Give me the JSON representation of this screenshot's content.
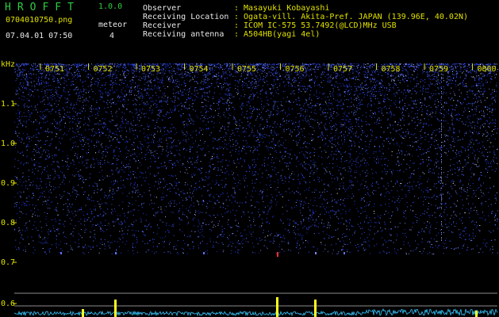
{
  "header": {
    "logo_text": "HROFFT",
    "version": "1.0.0",
    "filename": "0704010750.png",
    "meteor_label": "meteor",
    "date_time": "07.04.01 07:50",
    "meteor_count": "4"
  },
  "info": {
    "rows": [
      {
        "key": "Observer",
        "value": ": Masayuki Kobayashi"
      },
      {
        "key": "Receiving Location",
        "value": ": Ogata-vill. Akita-Pref. JAPAN (139.96E, 40.02N)"
      },
      {
        "key": "Receiver",
        "value": ": ICOM IC-575 53.7492(@LCD)MHz USB"
      },
      {
        "key": "Receiving antenna",
        "value": ": A504HB(yagi 4el)"
      }
    ]
  },
  "spectrogram": {
    "y_unit": "kHz",
    "y_ticks": [
      "1.1",
      "1.0",
      "0.9",
      "0.8",
      "0.7",
      "0.6"
    ],
    "time_ticks": [
      "0751",
      "0752",
      "0753",
      "0754",
      "0755",
      "0756",
      "0757",
      "0758",
      "0759",
      "0800"
    ],
    "colors": {
      "noise": "#2a44ff",
      "label": "#e0e000",
      "trace": "#ffff20",
      "meteor": "#ff3030"
    }
  }
}
